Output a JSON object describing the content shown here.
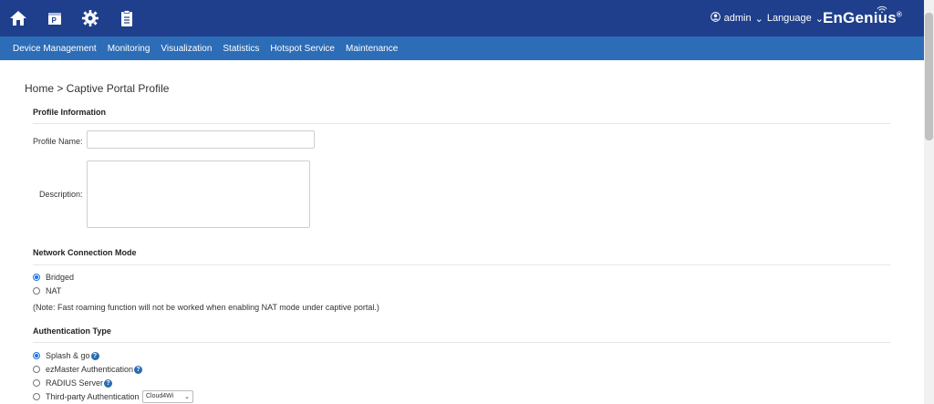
{
  "brand": {
    "name": "EnGenius",
    "trademark": "®"
  },
  "header": {
    "user": "admin",
    "language": "Language",
    "icons": [
      "home-icon",
      "portal-icon",
      "gear-icon",
      "clipboard-icon"
    ]
  },
  "nav": {
    "items": [
      "Device Management",
      "Monitoring",
      "Visualization",
      "Statistics",
      "Hotspot Service",
      "Maintenance"
    ]
  },
  "page": {
    "breadcrumb": "Home > Captive Portal Profile"
  },
  "profile": {
    "section_title": "Profile Information",
    "name_label": "Profile Name:",
    "name_value": "",
    "description_label": "Description:",
    "description_value": ""
  },
  "network": {
    "section_title": "Network Connection Mode",
    "options": [
      "Bridged",
      "NAT"
    ],
    "selected": "Bridged",
    "note": "(Note: Fast roaming function will not be worked when enabling NAT mode under captive portal.)"
  },
  "auth": {
    "section_title": "Authentication Type",
    "options": [
      "Splash & go",
      "ezMaster Authentication",
      "RADIUS Server",
      "Third-party Authentication"
    ],
    "selected": "Splash & go",
    "third_party_value": "Cloud4Wi"
  },
  "colors": {
    "topbar": "#1f3f8c",
    "navbar": "#2d6cb6",
    "accent": "#1a73e8"
  }
}
